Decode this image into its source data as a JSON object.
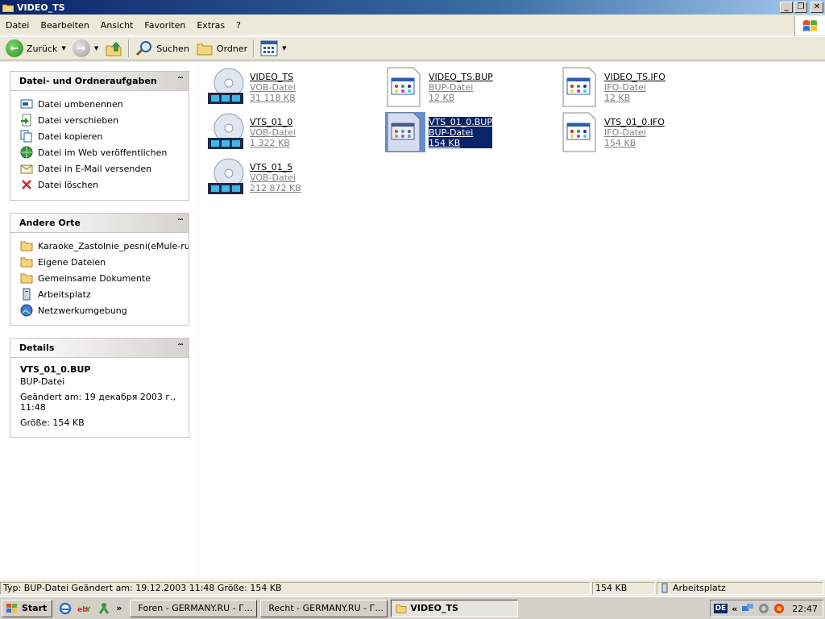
{
  "window": {
    "title": "VIDEO_TS"
  },
  "caption_buttons": {
    "minimize": "_",
    "restore": "❐",
    "close": "✕"
  },
  "menu": [
    "Datei",
    "Bearbeiten",
    "Ansicht",
    "Favoriten",
    "Extras",
    "?"
  ],
  "toolbar": {
    "back": "Zurück",
    "search": "Suchen",
    "folders": "Ordner"
  },
  "panels": {
    "tasks": {
      "title": "Datei- und Ordneraufgaben",
      "items": [
        "Datei umbenennen",
        "Datei verschieben",
        "Datei kopieren",
        "Datei im Web veröffentlichen",
        "Datei in E-Mail versenden",
        "Datei löschen"
      ]
    },
    "places": {
      "title": "Andere Orte",
      "items": [
        "Karaoke_Zastolnie_pesni(eMule-rus",
        "Eigene Dateien",
        "Gemeinsame Dokumente",
        "Arbeitsplatz",
        "Netzwerkumgebung"
      ]
    },
    "details": {
      "title": "Details",
      "name": "VTS_01_0.BUP",
      "type": "BUP-Datei",
      "modified": "Geändert am: 19 декабря 2003 г., 11:48",
      "size": "Größe: 154 KB"
    }
  },
  "files": [
    {
      "name": "VIDEO_TS",
      "type": "VOB-Datei",
      "size": "31 118 KB",
      "icon": "dvd-video-icon"
    },
    {
      "name": "VIDEO_TS.BUP",
      "type": "BUP-Datei",
      "size": "12 KB",
      "icon": "generic-file-icon"
    },
    {
      "name": "VIDEO_TS.IFO",
      "type": "IFO-Datei",
      "size": "12 KB",
      "icon": "generic-file-icon"
    },
    {
      "name": "VTS_01_0",
      "type": "VOB-Datei",
      "size": "1 322 KB",
      "icon": "dvd-video-icon"
    },
    {
      "name": "VTS_01_0.BUP",
      "type": "BUP-Datei",
      "size": "154 KB",
      "icon": "generic-file-icon",
      "selected": true
    },
    {
      "name": "VTS_01_0.IFO",
      "type": "IFO-Datei",
      "size": "154 KB",
      "icon": "generic-file-icon"
    },
    {
      "name": "VTS_01_5",
      "type": "VOB-Datei",
      "size": "212 872 KB",
      "icon": "dvd-video-icon"
    }
  ],
  "statusbar": {
    "info": "Typ: BUP-Datei Geändert am: 19.12.2003 11:48 Größe: 154 KB",
    "size": "154 KB",
    "location": "Arbeitsplatz"
  },
  "taskbar": {
    "start": "Start",
    "quicklaunch_more": "»",
    "tasks": [
      {
        "label": "Foren - GERMANY.RU - Г...",
        "active": false
      },
      {
        "label": "Recht - GERMANY.RU - Г...",
        "active": false
      },
      {
        "label": "VIDEO_TS",
        "active": true
      }
    ],
    "lang": "DE",
    "tray_more": "«",
    "clock": "22:47"
  }
}
